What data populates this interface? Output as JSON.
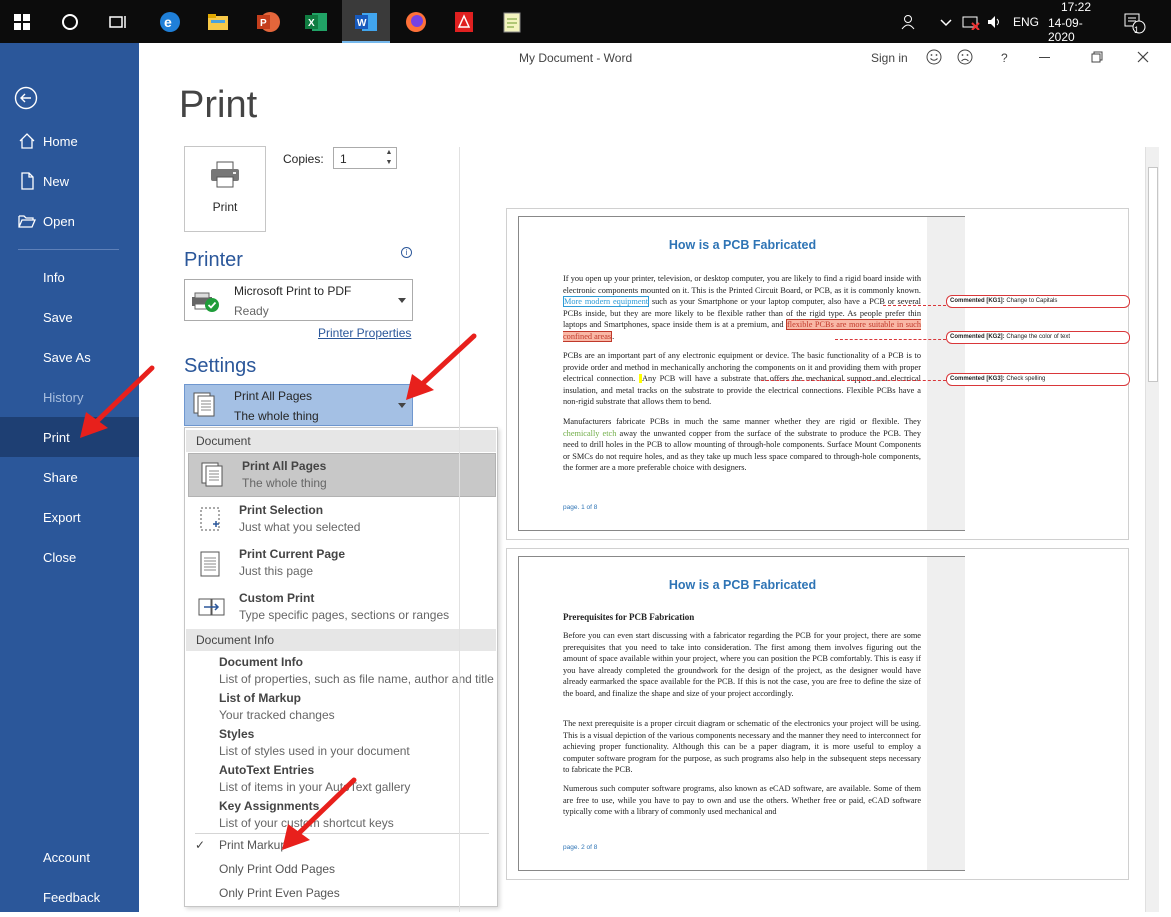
{
  "taskbar": {
    "language": "ENG",
    "time": "17:22",
    "date": "14-09-2020",
    "notification_count": "1",
    "apps": [
      "windows-start",
      "search-cortana",
      "task-view",
      "edge",
      "file-explorer",
      "powerpoint",
      "excel",
      "word",
      "firefox",
      "acrobat",
      "notepad-plus"
    ]
  },
  "titlebar": {
    "title": "My Document  -  Word",
    "sign_in": "Sign in",
    "help": "?"
  },
  "nav": {
    "items": [
      {
        "label": "Home"
      },
      {
        "label": "New"
      },
      {
        "label": "Open"
      },
      {
        "label": "Info"
      },
      {
        "label": "Save"
      },
      {
        "label": "Save As"
      },
      {
        "label": "History"
      },
      {
        "label": "Print"
      },
      {
        "label": "Share"
      },
      {
        "label": "Export"
      },
      {
        "label": "Close"
      },
      {
        "label": "Account"
      },
      {
        "label": "Feedback"
      }
    ]
  },
  "print": {
    "title": "Print",
    "button_label": "Print",
    "copies_label": "Copies:",
    "copies_value": "1"
  },
  "printer": {
    "heading": "Printer",
    "name": "Microsoft Print to PDF",
    "status": "Ready",
    "properties_link": "Printer Properties"
  },
  "settings": {
    "heading": "Settings",
    "selected_main": "Print All Pages",
    "selected_sub": "The whole thing"
  },
  "menu": {
    "document_header": "Document",
    "document_items": [
      {
        "title": "Print All Pages",
        "sub": "The whole thing"
      },
      {
        "title": "Print Selection",
        "sub": "Just what you selected"
      },
      {
        "title": "Print Current Page",
        "sub": "Just this page"
      },
      {
        "title": "Custom Print",
        "sub": "Type specific pages, sections or ranges"
      }
    ],
    "info_header": "Document Info",
    "info_items": [
      {
        "title": "Document Info",
        "sub": "List of properties, such as file name, author and title"
      },
      {
        "title": "List of Markup",
        "sub": "Your tracked changes"
      },
      {
        "title": "Styles",
        "sub": "List of styles used in your document"
      },
      {
        "title": "AutoText Entries",
        "sub": "List of items in your AutoText gallery"
      },
      {
        "title": "Key Assignments",
        "sub": "List of your custom shortcut keys"
      }
    ],
    "checkmark": "✓",
    "options": [
      "Print Markup",
      "Only Print Odd Pages",
      "Only Print Even Pages"
    ]
  },
  "preview": {
    "page1": {
      "heading": "How is a PCB Fabricated",
      "p1_a": "If you open up your printer, television, or desktop computer, you are likely to find a rigid board inside with electronic components mounted on it. This is the Printed Circuit Board, or PCB, as it is commonly known. ",
      "p1_hl1": "More modern equipment",
      "p1_b": " such as your Smartphone or your laptop computer, also have a PCB or several PCBs inside, but they are more likely to be flexible rather than of the rigid type. As people prefer thin laptops and Smartphones, space inside them is at a premium, and ",
      "p1_hl2": "flexible PCBs are more suitable in such confined areas",
      "p1_c": ".",
      "p2_a": "PCBs are an important part of any electronic equipment or device. The basic functionality of a PCB is to provide order and method in mechanically anchoring the components on it and providing them with proper electrical connection. ",
      "p2_b": "Any PCB will have a substrate that offers the mechanical support and electrical insulation, and metal tracks on the substrate to provide the electrical connections. Flexible PCBs have a non-rigid substrate that allows them to bend.",
      "p3_a": "Manufacturers fabricate PCBs in much the same manner whether they are rigid or flexible. They ",
      "p3_hl": "chemically etch",
      "p3_b": " away the unwanted copper from the surface of the substrate to produce the PCB. They need to drill holes in the PCB to allow mounting of through-hole components. Surface Mount Components or SMCs do not require holes, and as they take up much less space compared to through-hole components, the former are a more preferable choice with designers.",
      "page_num": "page. 1 of 8",
      "comments": [
        {
          "tag": "Commented [KG1]:",
          "text": " Change to Capitals"
        },
        {
          "tag": "Commented [KG2]:",
          "text": " Change the color of text"
        },
        {
          "tag": "Commented [KG3]:",
          "text": " Check spelling"
        }
      ]
    },
    "page2": {
      "heading": "How is a PCB Fabricated",
      "subheading": "Prerequisites for PCB Fabrication",
      "p1": "Before you can even start discussing with a fabricator regarding the PCB for your project, there are some prerequisites that you need to take into consideration. The first among them involves figuring out the amount of space available within your project, where you can position the PCB comfortably. This is easy if you have already completed the groundwork for the design of the project, as the designer would have already earmarked the space available for the PCB. If this is not the case, you are free to define the size of the board, and finalize the shape and size of your project accordingly.",
      "p2": "The next prerequisite is a proper circuit diagram or schematic of the electronics your project will be using. This is a visual depiction of the various components necessary and the manner they need to interconnect for achieving proper functionality. Although this can be a paper diagram, it is more useful to employ a computer software program for the purpose, as such programs also help in the subsequent steps necessary to fabricate the PCB.",
      "p3": "Numerous such computer software programs, also known as eCAD software, are available. Some of them are free to use, while you have to pay to own and use the others. Whether free or paid, eCAD software typically come with a library of commonly used mechanical and",
      "page_num": "page. 2 of 8"
    }
  },
  "colors": {
    "nav_bg": "#2b579a",
    "nav_active": "#1e3f73",
    "accent": "#2b579a",
    "annotation_arrow": "#e8201c"
  }
}
